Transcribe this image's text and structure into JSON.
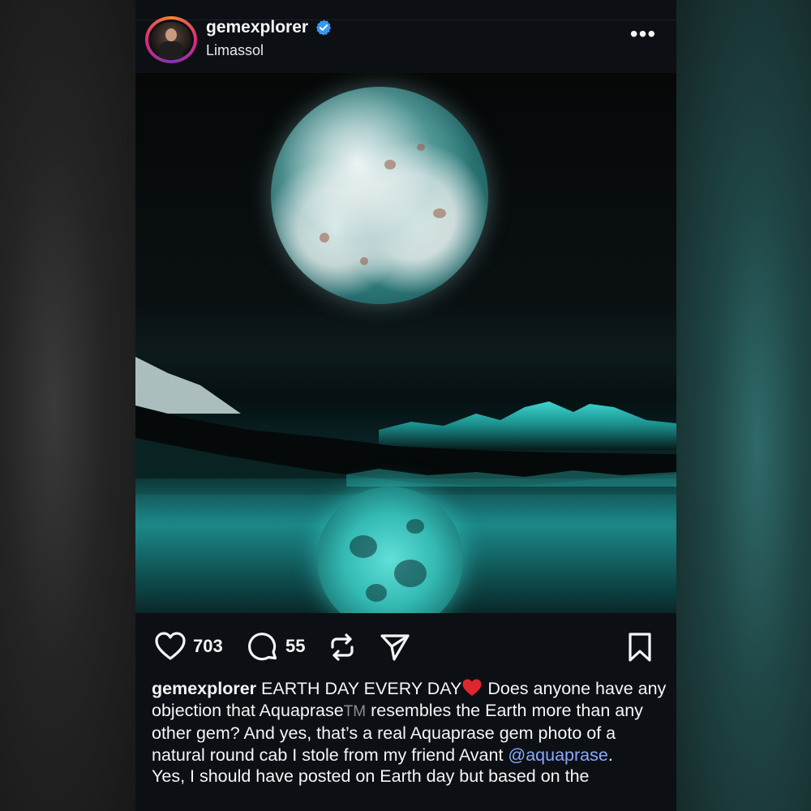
{
  "post": {
    "username": "gemexplorer",
    "location": "Limassol",
    "more_label": "•••",
    "likes": "703",
    "comments": "55",
    "caption": {
      "username": "gemexplorer",
      "part1": " EARTH DAY EVERY DAY",
      "part2": " Does anyone have any objection that Aquaprase",
      "tm": "TM",
      "part3": " resembles the Earth more than any other gem? And yes, that’s  a real Aquaprase gem photo of a natural round cab I stole from my friend Avant ",
      "mention": "@aquaprase",
      "part4": ".",
      "line2": "Yes, I should have posted on Earth day but based on the"
    }
  },
  "icons": {
    "avatar": "avatar",
    "verified": "verified-badge-icon",
    "more": "more-options-icon",
    "like": "heart-icon",
    "comment": "comment-bubble-icon",
    "repost": "repost-icon",
    "share": "send-icon",
    "save": "bookmark-icon",
    "emoji": "red-heart-emoji"
  },
  "colors": {
    "background": "#0c1014",
    "text": "#f5f5f5",
    "mention": "#8aa8ff",
    "verified": "#3897f0",
    "heart_emoji": "#e0262e"
  }
}
